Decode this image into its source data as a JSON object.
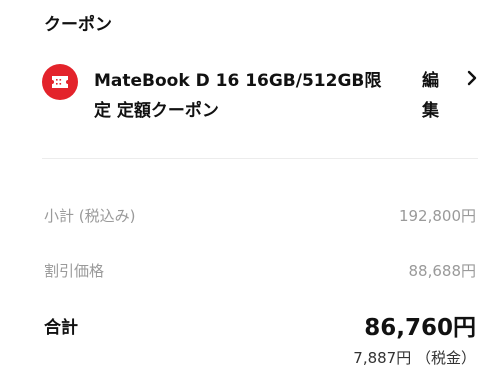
{
  "coupon_section": {
    "title": "クーポン",
    "coupon_name": "MateBook D 16 16GB/512GB限定 定額クーポン",
    "edit_label": "編集",
    "icon": "coupon-ticket-icon",
    "chevron_icon": "chevron-right-icon",
    "accent_color": "#e3232b"
  },
  "summary": {
    "subtotal_label": "小計 (税込み)",
    "subtotal_value": "192,800円",
    "discount_label": "割引価格",
    "discount_value": "88,688円",
    "total_label": "合計",
    "total_value": "86,760円",
    "tax_note": "7,887円 （税金）"
  }
}
